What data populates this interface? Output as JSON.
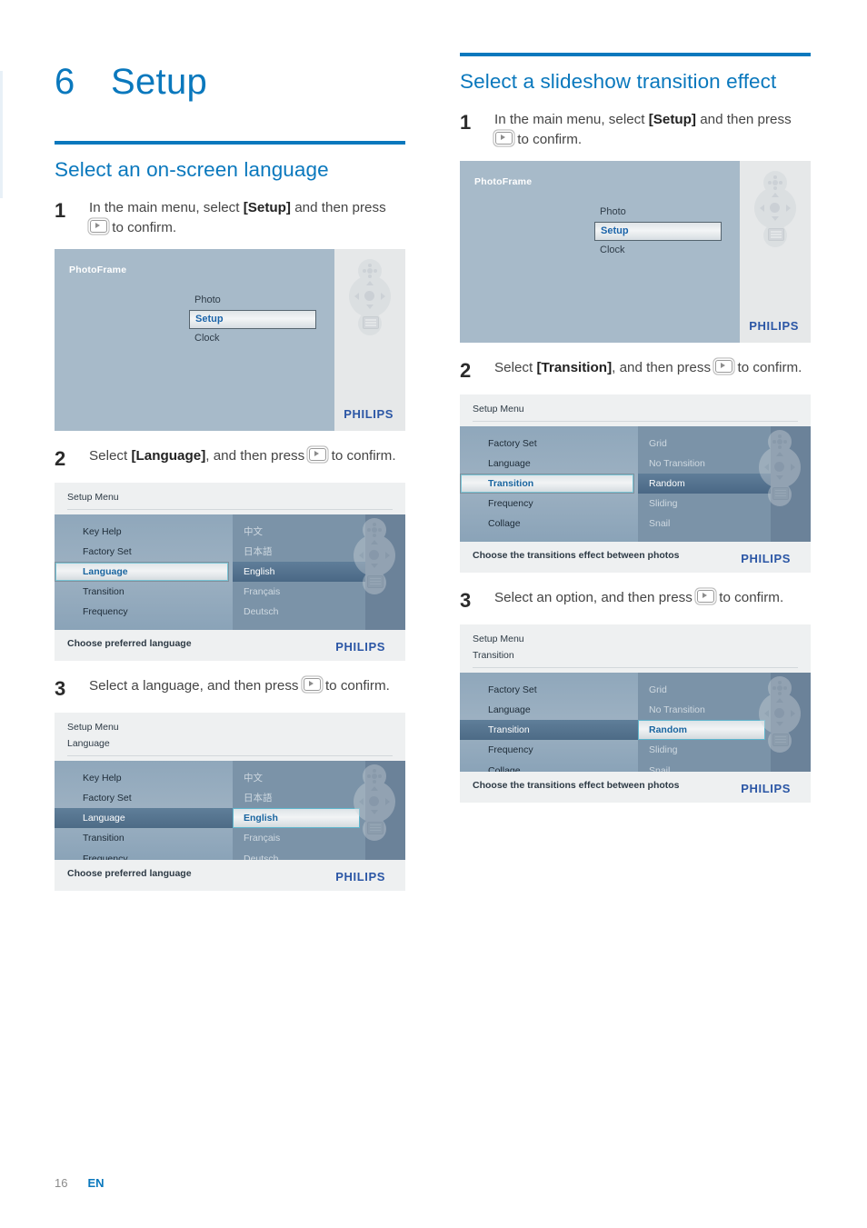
{
  "chapter": {
    "number": "6",
    "title": "Setup"
  },
  "footer": {
    "page": "16",
    "language": "EN"
  },
  "left_column": {
    "heading": "Select an on-screen language",
    "steps": [
      {
        "number": "1",
        "text_before": "In the main menu, select ",
        "bold": "[Setup]",
        "text_after": " and then press ",
        "text_end": " to confirm."
      },
      {
        "number": "2",
        "text_before": "Select ",
        "bold": "[Language]",
        "text_after": ", and then press ",
        "text_end": " to confirm."
      },
      {
        "number": "3",
        "text_before": "Select a language, and then press ",
        "bold": "",
        "text_after": "",
        "text_end": " to confirm."
      }
    ],
    "screens": [
      {
        "type": "home",
        "title": "PhotoFrame",
        "items": [
          "Photo",
          "Setup",
          "Clock"
        ],
        "selected": "Setup",
        "brand": "PHILIPS"
      },
      {
        "type": "menu",
        "breadcrumb": [
          "Setup Menu"
        ],
        "left_items": [
          "Key Help",
          "Factory Set",
          "Language",
          "Transition",
          "Frequency"
        ],
        "left_selected": "Language",
        "left_highlighted": "",
        "options": [
          "中文",
          "日本語",
          "English",
          "Français",
          "Deutsch"
        ],
        "option_highlighted": "English",
        "option_selected": "",
        "hint": "Choose preferred language",
        "brand": "PHILIPS"
      },
      {
        "type": "menu",
        "breadcrumb": [
          "Setup Menu",
          "Language"
        ],
        "left_items": [
          "Key Help",
          "Factory Set",
          "Language",
          "Transition",
          "Frequency"
        ],
        "left_selected": "",
        "left_highlighted": "Language",
        "options": [
          "中文",
          "日本語",
          "English",
          "Français",
          "Deutsch"
        ],
        "option_highlighted": "",
        "option_selected": "English",
        "hint": "Choose preferred language",
        "brand": "PHILIPS"
      }
    ]
  },
  "right_column": {
    "heading": "Select a slideshow transition effect",
    "steps": [
      {
        "number": "1",
        "text_before": "In the main menu, select ",
        "bold": "[Setup]",
        "text_after": " and then press ",
        "text_end": " to confirm."
      },
      {
        "number": "2",
        "text_before": "Select ",
        "bold": "[Transition]",
        "text_after": ", and then press ",
        "text_end": " to confirm."
      },
      {
        "number": "3",
        "text_before": "Select an option, and then press ",
        "bold": "",
        "text_after": "",
        "text_end": " to confirm."
      }
    ],
    "screens": [
      {
        "type": "home",
        "title": "PhotoFrame",
        "items": [
          "Photo",
          "Setup",
          "Clock"
        ],
        "selected": "Setup",
        "brand": "PHILIPS"
      },
      {
        "type": "menu",
        "breadcrumb": [
          "Setup Menu"
        ],
        "left_items": [
          "Factory Set",
          "Language",
          "Transition",
          "Frequency",
          "Collage"
        ],
        "left_selected": "Transition",
        "left_highlighted": "",
        "options": [
          "Grid",
          "No Transition",
          "Random",
          "Sliding",
          "Snail"
        ],
        "option_highlighted": "Random",
        "option_selected": "",
        "hint": "Choose the transitions effect between photos",
        "brand": "PHILIPS"
      },
      {
        "type": "menu",
        "breadcrumb": [
          "Setup Menu",
          "Transition"
        ],
        "left_items": [
          "Factory Set",
          "Language",
          "Transition",
          "Frequency",
          "Collage"
        ],
        "left_selected": "",
        "left_highlighted": "Transition",
        "options": [
          "Grid",
          "No Transition",
          "Random",
          "Sliding",
          "Snail"
        ],
        "option_highlighted": "",
        "option_selected": "Random",
        "hint": "Choose the transitions effect between photos",
        "brand": "PHILIPS"
      }
    ]
  },
  "icons": {
    "confirm_key": "play-key-icon",
    "remote": "remote-control-icon"
  },
  "colors": {
    "accent": "#0a78bd",
    "brand": "#2b56a5",
    "screen_bg": "#a7bac9"
  }
}
